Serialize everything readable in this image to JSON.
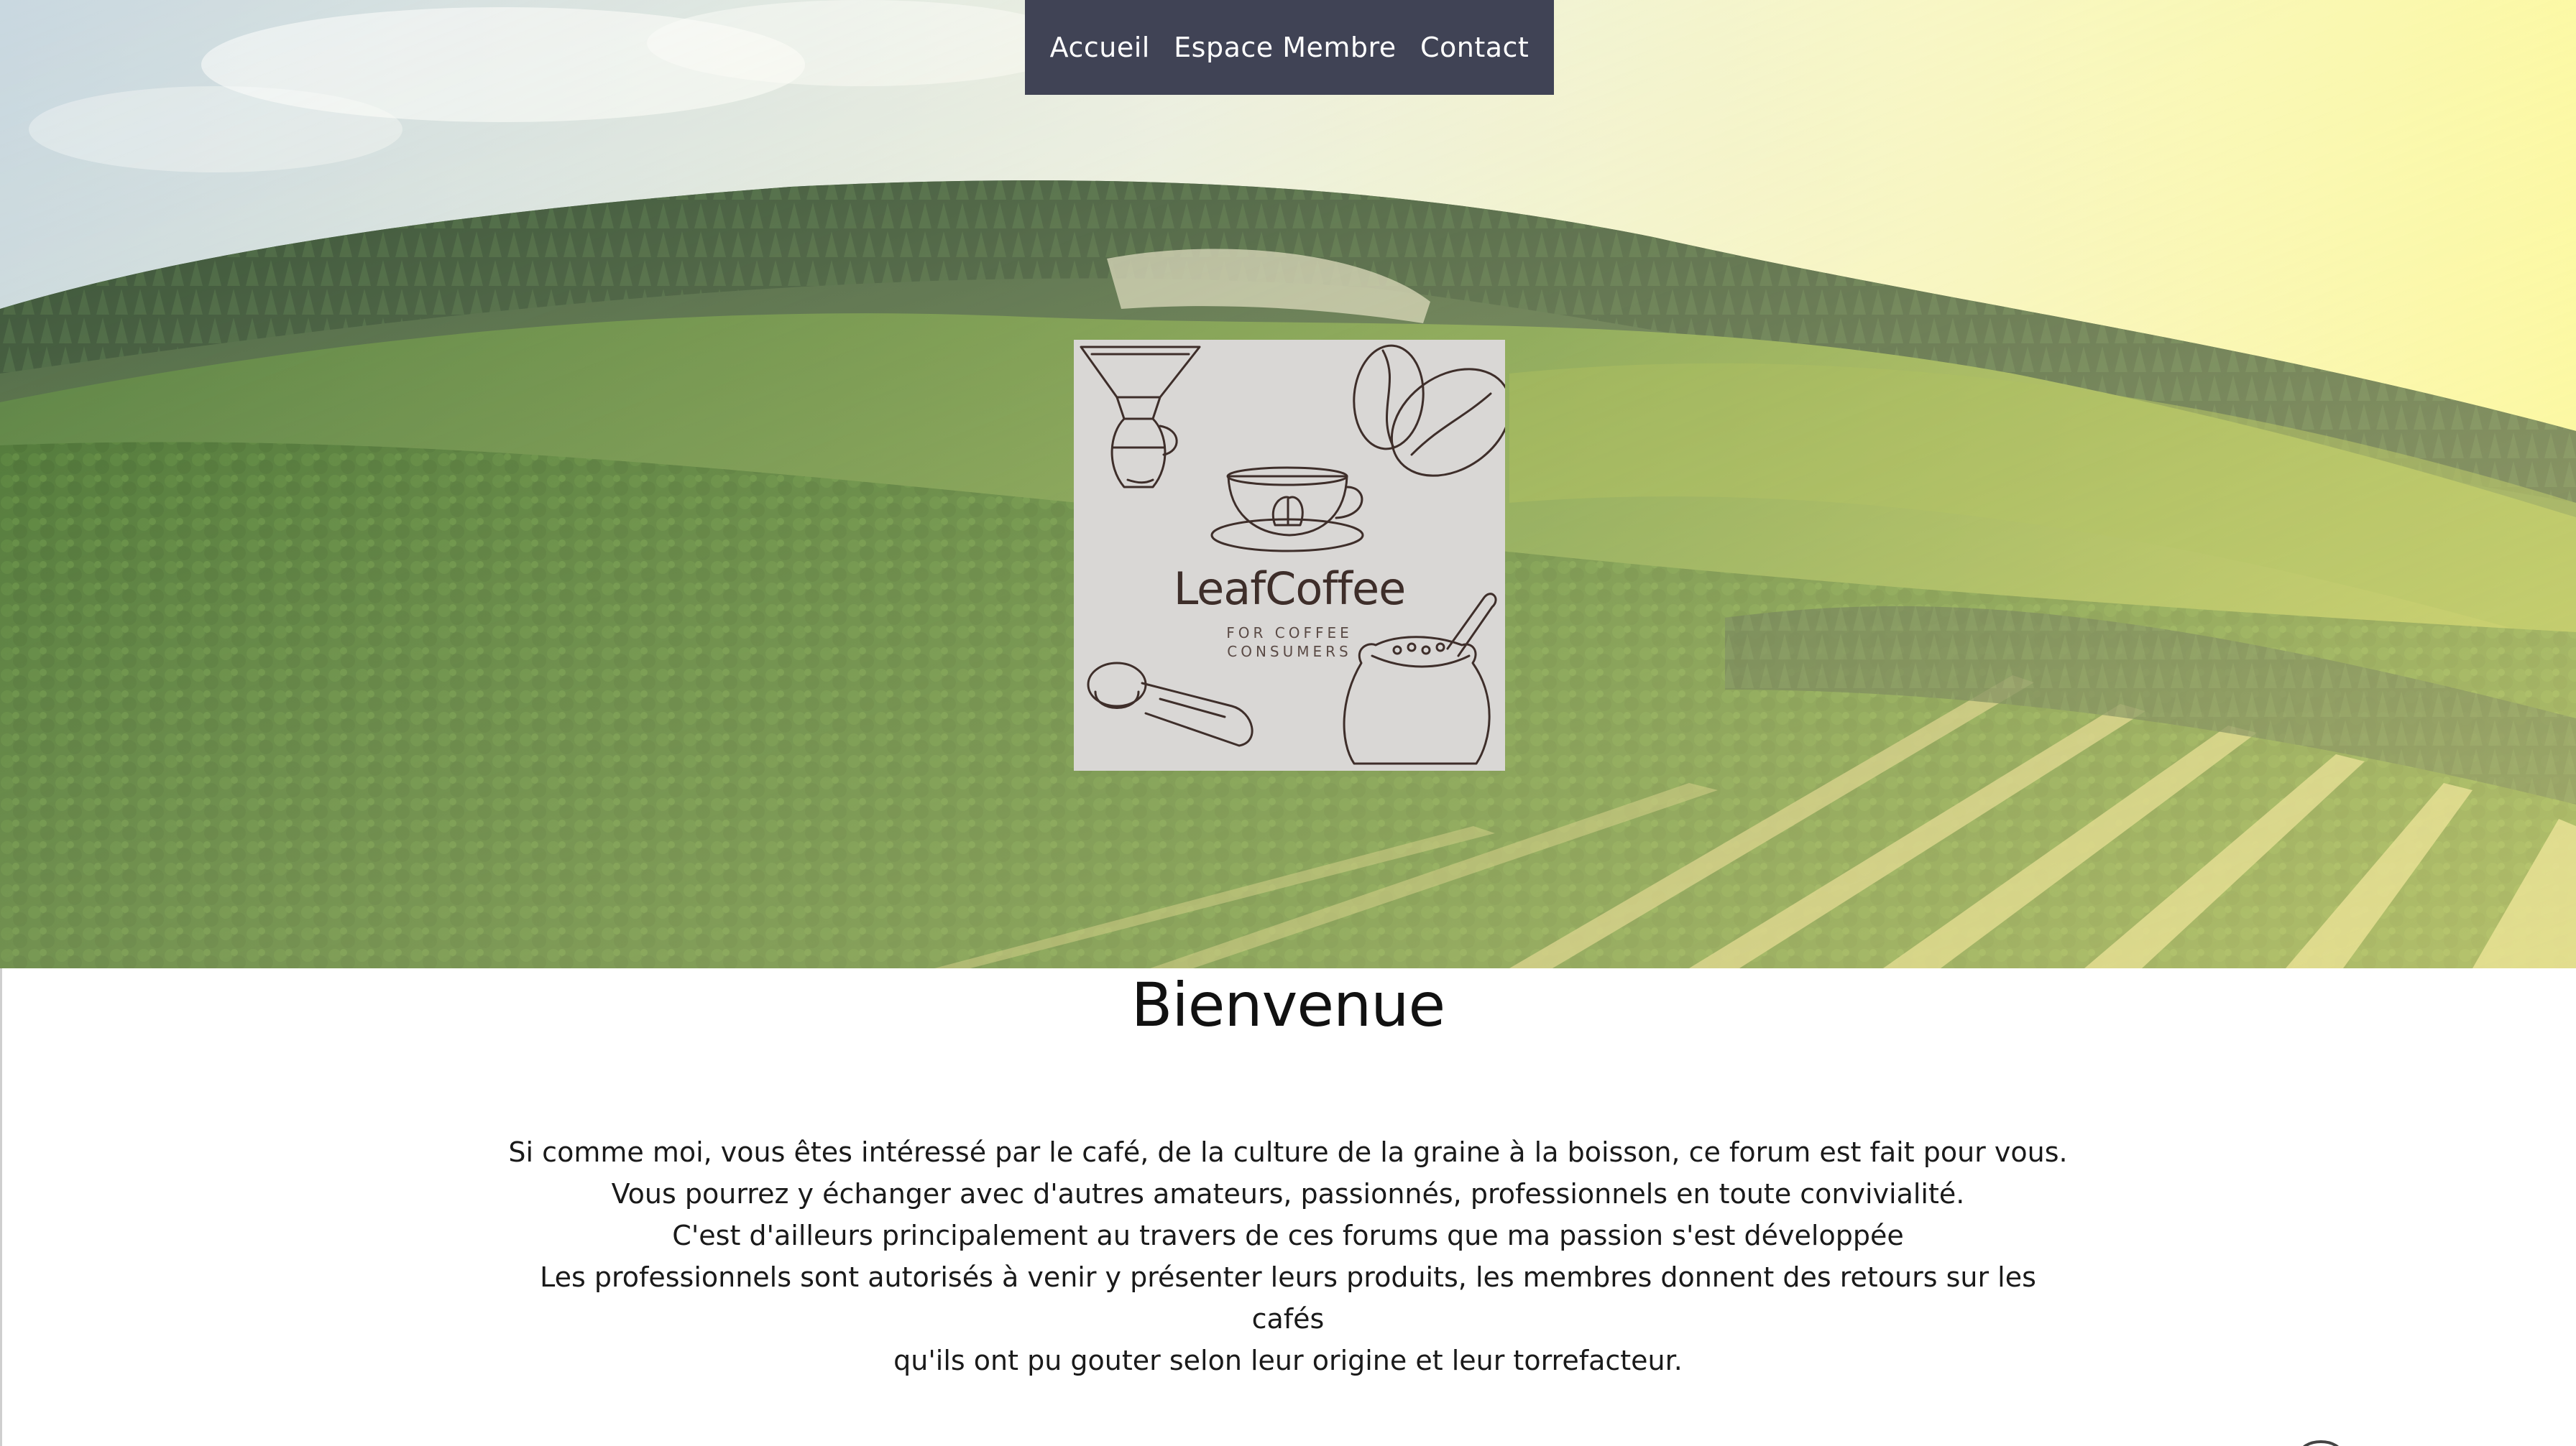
{
  "nav": {
    "items": [
      {
        "label": "Accueil"
      },
      {
        "label": "Espace Membre"
      },
      {
        "label": "Contact"
      }
    ]
  },
  "logo": {
    "title": "LeafCoffee",
    "subtitle_line1": "FOR COFFEE",
    "subtitle_line2": "CONSUMERS"
  },
  "main": {
    "heading": "Bienvenue",
    "paragraph_lines": [
      "Si comme moi, vous êtes intéressé par le café, de la culture de la graine à la boisson, ce forum est fait pour vous.",
      "Vous pourrez y échanger avec d'autres amateurs, passionnés, professionnels en toute convivialité.",
      "C'est d'ailleurs principalement au travers de ces forums que ma passion s'est développée",
      "Les professionnels sont autorisés à venir y présenter leurs produits, les membres donnent des retours sur les cafés",
      "qu'ils ont pu gouter selon leur origine et leur torrefacteur."
    ]
  },
  "colors": {
    "nav_background": "#404355",
    "nav_text": "#ffffff",
    "logo_background": "#d9d7d5",
    "logo_ink": "#3e2e2a"
  }
}
